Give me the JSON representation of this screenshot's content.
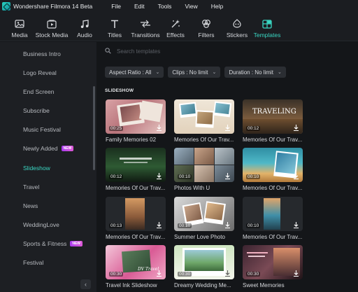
{
  "app": {
    "title": "Wondershare Filmora 14 Beta"
  },
  "menu": [
    "File",
    "Edit",
    "Tools",
    "View",
    "Help"
  ],
  "toolbar": [
    {
      "label": "Media",
      "icon": "media-icon"
    },
    {
      "label": "Stock Media",
      "icon": "stock-media-icon"
    },
    {
      "label": "Audio",
      "icon": "audio-icon"
    },
    {
      "label": "Titles",
      "icon": "titles-icon"
    },
    {
      "label": "Transitions",
      "icon": "transitions-icon"
    },
    {
      "label": "Effects",
      "icon": "effects-icon"
    },
    {
      "label": "Filters",
      "icon": "filters-icon"
    },
    {
      "label": "Stickers",
      "icon": "stickers-icon"
    },
    {
      "label": "Templates",
      "icon": "templates-icon",
      "active": true
    }
  ],
  "sidebar": {
    "items": [
      {
        "label": "Business Intro"
      },
      {
        "label": "Logo Reveal"
      },
      {
        "label": "End Screen"
      },
      {
        "label": "Subscribe"
      },
      {
        "label": "Music Festival"
      },
      {
        "label": "Newly Added",
        "badge": "NEW"
      },
      {
        "label": "Slideshow",
        "active": true
      },
      {
        "label": "Travel"
      },
      {
        "label": "News"
      },
      {
        "label": "WeddingLove"
      },
      {
        "label": "Sports & Fitness",
        "badge": "NEW"
      },
      {
        "label": "Festival"
      }
    ]
  },
  "search": {
    "placeholder": "Search templates"
  },
  "filters": [
    {
      "label": "Aspect Ratio : All"
    },
    {
      "label": "Clips : No limit"
    },
    {
      "label": "Duration : No limit"
    }
  ],
  "section": {
    "title": "SLIDESHOW"
  },
  "templates": [
    {
      "title": "Family Memories 02",
      "duration": "00:25"
    },
    {
      "title": "Memories Of Our Trav...",
      "duration": ""
    },
    {
      "title": "Memories Of Our Trav...",
      "duration": "00:12",
      "overlay": "TRAVELING"
    },
    {
      "title": "Memories Of Our Trav...",
      "duration": "00:12"
    },
    {
      "title": "Photos With U",
      "duration": "00:10"
    },
    {
      "title": "Memories Of Our Trav...",
      "duration": "00:10"
    },
    {
      "title": "Memories Of Our Trav...",
      "duration": "00:13"
    },
    {
      "title": "Summer Love Photo",
      "duration": "00:10"
    },
    {
      "title": "Memories Of Our Trav...",
      "duration": "00:10"
    },
    {
      "title": "Travel Ink Slideshow",
      "duration": "00:30",
      "overlay": "DV Travel"
    },
    {
      "title": "Dreamy Wedding Me...",
      "duration": "00:30"
    },
    {
      "title": "Sweet Memories",
      "duration": "00:30"
    }
  ],
  "colors": {
    "accent": "#3ad7c3",
    "background": "#141619",
    "sidebar": "#1d1f23",
    "new_badge": "#c04ae6"
  }
}
